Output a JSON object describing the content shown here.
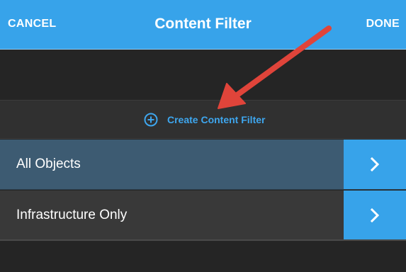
{
  "header": {
    "cancel_label": "CANCEL",
    "title": "Content Filter",
    "done_label": "DONE"
  },
  "create": {
    "label": "Create Content Filter",
    "icon": "plus-circle-icon"
  },
  "filters": [
    {
      "label": "All Objects",
      "selected": true,
      "icon": "chevron-right-icon"
    },
    {
      "label": "Infrastructure Only",
      "selected": false,
      "icon": "chevron-right-icon"
    }
  ],
  "annotation": {
    "icon": "red-arrow-annotation"
  },
  "colors": {
    "accent": "#37a3ea",
    "selected_row": "#3d5b72",
    "row": "#393939",
    "background": "#252525",
    "annotation_arrow": "#e0443a"
  }
}
